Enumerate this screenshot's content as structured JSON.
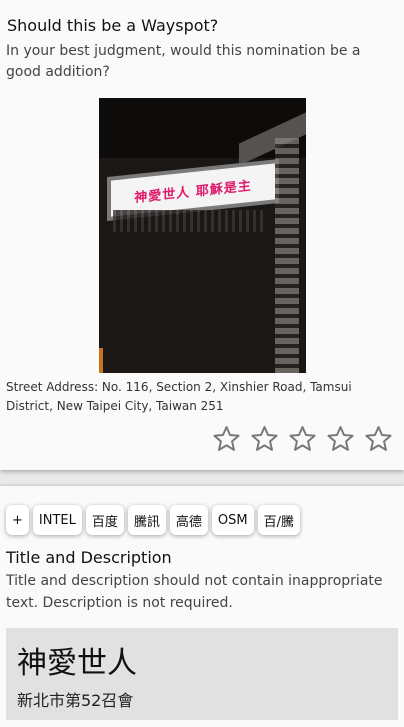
{
  "question": {
    "title": "Should this be a Wayspot?",
    "subtitle": "In your best judgment, would this nomination be a good addition?"
  },
  "photo": {
    "sign_text": "神愛世人 耶穌是主"
  },
  "address": "Street Address: No. 116, Section 2, Xinshier Road, Tamsui District, New Taipei City, Taiwan 251",
  "rating": {
    "max": 5,
    "value": 0,
    "star_icon": "star-outline-icon",
    "color": "#777777"
  },
  "map_buttons": [
    "+",
    "INTEL",
    "百度",
    "騰訊",
    "高德",
    "OSM",
    "百/騰"
  ],
  "title_description": {
    "heading": "Title and Description",
    "guidance": "Title and description should not contain inappropriate text. Description is not required."
  },
  "nomination": {
    "title": "神愛世人",
    "description": "新北市第52召會"
  }
}
